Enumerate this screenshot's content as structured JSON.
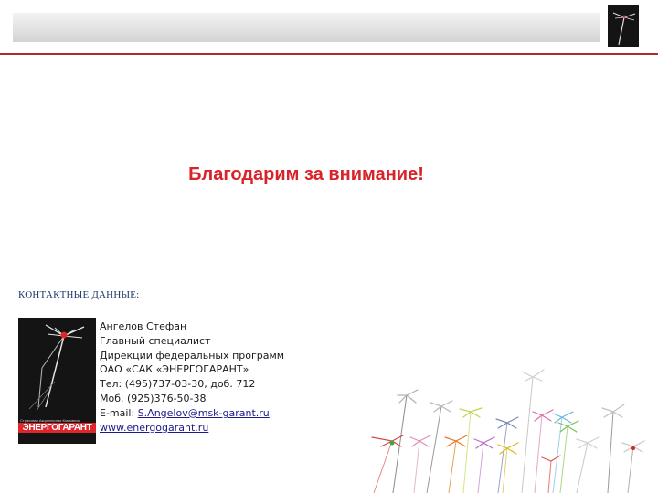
{
  "slide": {
    "thanks_text": "Благодарим за внимание!",
    "contacts_heading": "КОНТАКТНЫЕ ДАННЫЕ:"
  },
  "logo": {
    "caption": "Страховая Акционерная Компания",
    "name": "ЭНЕРГОГАРАНТ"
  },
  "contact": {
    "name": "Ангелов Стефан",
    "position": "Главный специалист",
    "department": "Дирекции федеральных программ",
    "company": "ОАО «САК «ЭНЕРГОГАРАНТ»",
    "phone": "Тел: (495)737-03-30, доб. 712",
    "mobile": "Моб. (925)376-50-38",
    "email_label": "E-mail: ",
    "email": "S.Angelov@msk-garant.ru",
    "website": "www.energogarant.ru"
  },
  "colors": {
    "accent": "#d8232a",
    "line": "#b3262b",
    "heading": "#1f3a6e",
    "logo_bg": "#141414"
  }
}
